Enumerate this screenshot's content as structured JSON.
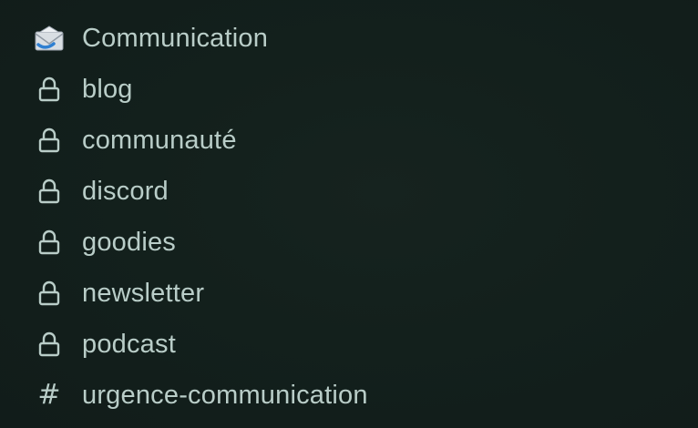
{
  "channels": [
    {
      "icon": "envelope-icon",
      "label": "Communication"
    },
    {
      "icon": "lock-icon",
      "label": "blog"
    },
    {
      "icon": "lock-icon",
      "label": "communauté"
    },
    {
      "icon": "lock-icon",
      "label": "discord"
    },
    {
      "icon": "lock-icon",
      "label": "goodies"
    },
    {
      "icon": "lock-icon",
      "label": "newsletter"
    },
    {
      "icon": "lock-icon",
      "label": "podcast"
    },
    {
      "icon": "hash-icon",
      "label": "urgence-communication"
    }
  ],
  "colors": {
    "background": "#14201e",
    "text": "#b9cdc8"
  },
  "hash_glyph": "#"
}
